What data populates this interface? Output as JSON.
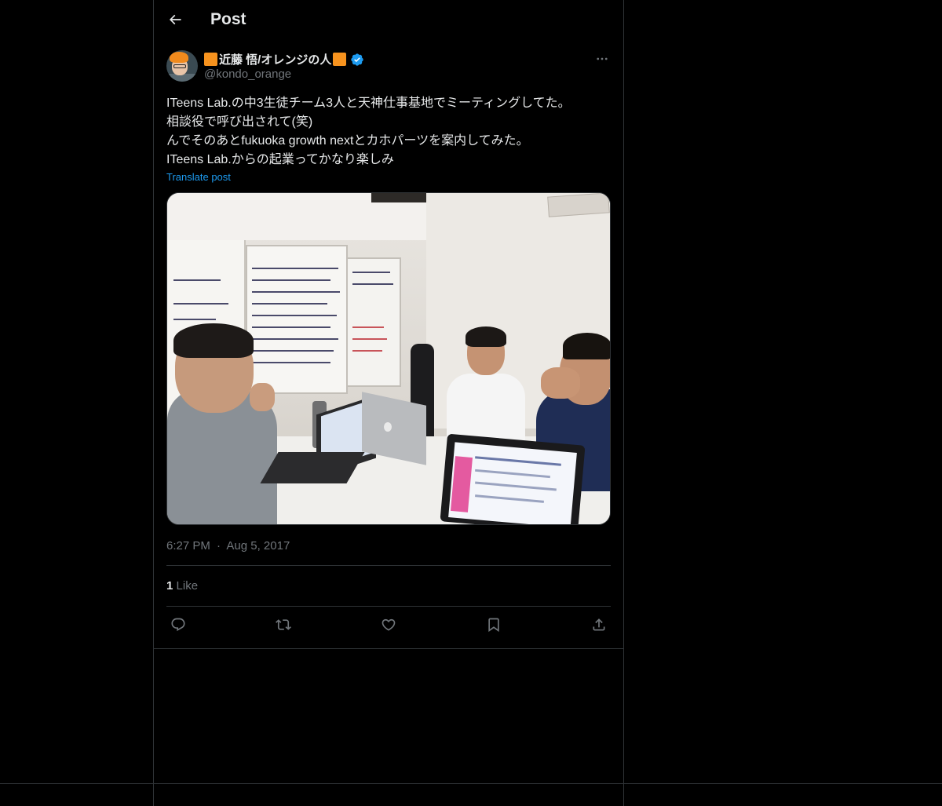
{
  "header": {
    "title": "Post",
    "back_icon": "arrow-left-icon"
  },
  "post": {
    "author": {
      "display_name": "近藤 悟/オレンジの人",
      "handle": "@kondo_orange",
      "verified": true,
      "name_accent_color": "#f7931e",
      "verified_color": "#1d9bf0"
    },
    "text": "ITeens Lab.の中3生徒チーム3人と天神仕事基地でミーティングしてた。\n相談役で呼び出されて(笑)\nんでそのあとfukuoka growth nextとカホパーツを案内してみた。\nITeens Lab.からの起業ってかなり楽しみ",
    "translate_label": "Translate post",
    "time": "6:27 PM",
    "separator": "·",
    "date": "Aug 5, 2017",
    "like_count": "1",
    "like_label": "Like"
  },
  "actions": [
    {
      "name": "reply",
      "icon": "reply-icon"
    },
    {
      "name": "repost",
      "icon": "repost-icon"
    },
    {
      "name": "like",
      "icon": "heart-icon"
    },
    {
      "name": "bookmark",
      "icon": "bookmark-icon"
    },
    {
      "name": "share",
      "icon": "share-icon"
    }
  ],
  "colors": {
    "background": "#000000",
    "border": "#2f3336",
    "text": "#e7e9ea",
    "muted": "#71767b",
    "link": "#1d9bf0"
  }
}
